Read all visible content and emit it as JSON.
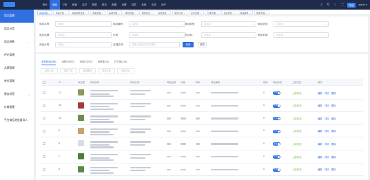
{
  "topnav": [
    "首页",
    "商品",
    "订单",
    "营销",
    "会员",
    "数据",
    "财务",
    "配置",
    "设置",
    "插件",
    "系统",
    "应用",
    "用户"
  ],
  "topnav_active": 1,
  "topright": {
    "icons": [
      "search-icon",
      "refresh-icon",
      "bell-icon",
      "fullscreen-icon"
    ],
    "tag": "平台",
    "user": "admin ▾"
  },
  "sidebar": [
    {
      "label": "商品管理",
      "active": true,
      "chev": ""
    },
    {
      "label": "商品分类",
      "active": false,
      "chev": ""
    },
    {
      "label": "商品参数",
      "active": false,
      "chev": "⌄"
    },
    {
      "label": "评论管理",
      "active": false,
      "chev": ""
    },
    {
      "label": "品牌管理",
      "active": false,
      "chev": ""
    },
    {
      "label": "单位管理",
      "active": false,
      "chev": ""
    },
    {
      "label": "服务标签",
      "active": false,
      "chev": "⌄"
    },
    {
      "label": "价格管理",
      "active": false,
      "chev": ""
    },
    {
      "label": "平台商品池批量导入",
      "active": false,
      "chev": ""
    }
  ],
  "tabs": [
    "商品管理",
    "商品分类",
    "商品参数设置",
    "规格管理",
    "品牌管理",
    "单位管理",
    "服务标签",
    "运费模板",
    "物流公司",
    "评论管理",
    "分类管理",
    "退货原因",
    "商品推荐",
    "服务管理"
  ],
  "filter": {
    "labels": [
      "商品名称:",
      "商品编码:",
      "商品类型:",
      "商品状态:",
      "商品品牌:",
      "分类:",
      "供应商:",
      "商品来源:",
      "商品分类:",
      "店铺名称:"
    ],
    "placeholders": [
      "请输入",
      "请选择",
      "请选择",
      "请选择",
      "请选择",
      "请选择",
      "请选择",
      "请选择",
      "请输入",
      "请输入关键词/名称/编码"
    ],
    "search_label": "查询",
    "reset_label": "重置"
  },
  "subtabs": [
    "全部商品(888)",
    "出售中(520)",
    "仓库中(210)",
    "待审核(32)",
    "已下架(126)"
  ],
  "actions": [
    "批量上架",
    "批量下架",
    "批量删除",
    "批量导出",
    "批量改价"
  ],
  "columns": [
    "",
    "ID",
    "商品图",
    "商品名称",
    "商品分类",
    "商品品牌",
    "价格",
    "库存",
    "商品编码",
    "销量",
    "商品状态",
    "上架状态",
    "操作"
  ],
  "rows": [
    {
      "id": "17",
      "sales": "0",
      "status": "上架",
      "shelf": "上架状态",
      "ops": [
        "编辑",
        "详情",
        "删除"
      ],
      "thumb": "#8a9a5b"
    },
    {
      "id": "16",
      "sales": "0",
      "status": "上架",
      "shelf": "上架状态",
      "ops": [
        "编辑",
        "详情",
        "删除"
      ],
      "thumb": "#a33b3b"
    },
    {
      "id": "15",
      "sales": "0",
      "status": "上架",
      "shelf": "上架状态",
      "ops": [
        "编辑",
        "详情",
        "删除"
      ],
      "thumb": "#6b8e4e"
    },
    {
      "id": "9",
      "sales": "0",
      "status": "上架",
      "shelf": "上架状态",
      "ops": [
        "编辑",
        "详情",
        "删除"
      ],
      "thumb": "#c8a36a"
    },
    {
      "id": "8",
      "sales": "0",
      "status": "上架",
      "shelf": "上架状态",
      "ops": [
        "编辑",
        "详情",
        "删除"
      ],
      "thumb": "#d9dde3"
    },
    {
      "id": "7",
      "sales": "0",
      "status": "上架",
      "shelf": "上架状态",
      "ops": [
        "编辑",
        "详情",
        "删除"
      ],
      "thumb": "#4f7d3a"
    },
    {
      "id": "6",
      "sales": "0",
      "status": "上架",
      "shelf": "上架状态",
      "ops": [
        "编辑",
        "详情",
        "删除"
      ],
      "thumb": "#5a8a46"
    }
  ],
  "colors": {
    "accent": "#2f6fe0",
    "topbar": "#1e2b4a",
    "success": "#67c23a"
  }
}
